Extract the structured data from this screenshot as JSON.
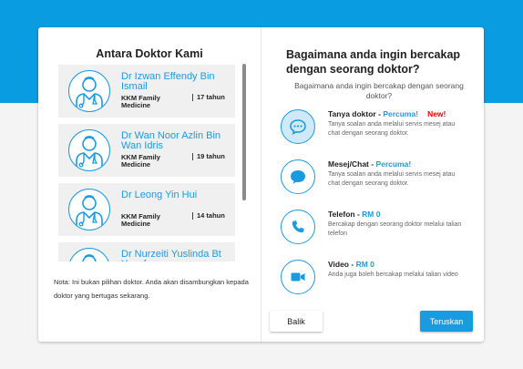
{
  "colors": {
    "brand": "#0a9ce0",
    "accent": "#1a9be0",
    "new_badge": "#e00000"
  },
  "left": {
    "title": "Antara Doktor Kami",
    "doctors": [
      {
        "name": "Dr Izwan Effendy Bin Ismail",
        "specialty": "KKM Family Medicine",
        "experience": "17 tahun"
      },
      {
        "name": "Dr Wan Noor Azlin Bin Wan Idris",
        "specialty": "KKM Family Medicine",
        "experience": "19 tahun"
      },
      {
        "name": "Dr Leong Yin Hui",
        "specialty": "KKM Family Medicine",
        "experience": "14 tahun"
      },
      {
        "name": "Dr Nurzeiti Yuslinda Bt Yusof",
        "specialty": "",
        "experience": ""
      }
    ],
    "note": "Nota: Ini bukan pilihan doktor. Anda akan disambungkan kepada doktor yang bertugas sekarang."
  },
  "right": {
    "title": "Bagaimana anda ingin bercakap dengan seorang doktor?",
    "subtitle": "Bagaimana anda ingin bercakap dengan seorang doktor?",
    "options": [
      {
        "name": "Tanya doktor",
        "price": "Percuma!",
        "badge": "New!",
        "desc": "Tanya soalan anda melalui servis mesej atau chat dengan seorang doktor.",
        "icon": "chat-bubble-dots-icon"
      },
      {
        "name": "Mesej/Chat",
        "price": "Percuma!",
        "desc": "Tanya soalan anda melalui servis mesej atau chat dengan seorang doktor.",
        "icon": "message-bubble-icon"
      },
      {
        "name": "Telefon",
        "price": "RM 0",
        "desc": "Bercakap dengan seorang doktor melalui talian telefon",
        "icon": "phone-icon"
      },
      {
        "name": "Video",
        "price": "RM 0",
        "desc": "Anda juga boleh bercakap melalui talian video",
        "icon": "video-camera-icon"
      }
    ]
  },
  "buttons": {
    "back": "Balik",
    "next": "Teruskan"
  }
}
